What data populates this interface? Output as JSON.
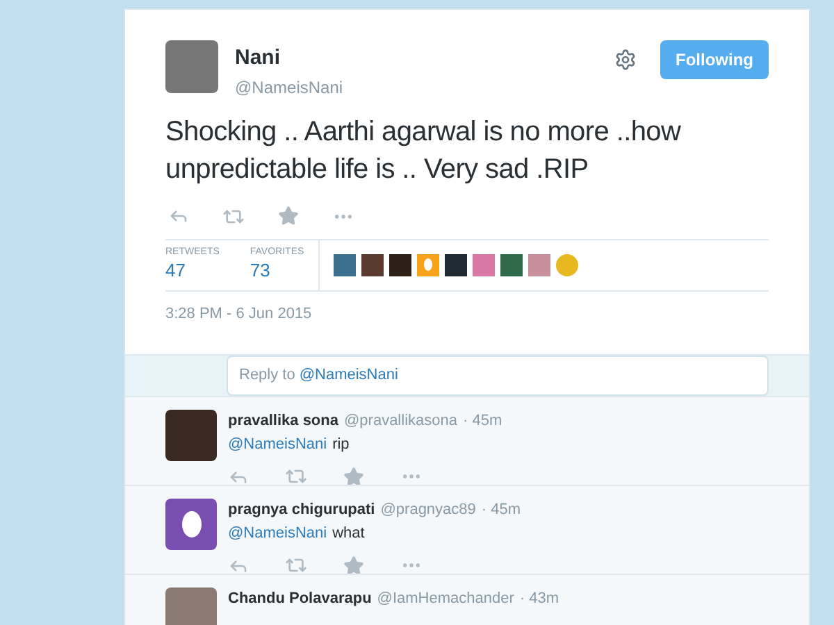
{
  "tweet": {
    "name": "Nani",
    "handle": "@NameisNani",
    "follow_button": "Following",
    "text": "Shocking .. Aarthi agarwal is no more ..how unpredictable life is .. Very sad .RIP",
    "stats": [
      {
        "label": "RETWEETS",
        "value": "47"
      },
      {
        "label": "FAVORITES",
        "value": "73"
      }
    ],
    "favoriters": [
      {
        "kind": "photo",
        "color": "#3d6f8f"
      },
      {
        "kind": "photo",
        "color": "#5a3a2e"
      },
      {
        "kind": "photo",
        "color": "#2e2118"
      },
      {
        "kind": "egg",
        "color": "#f7a21b"
      },
      {
        "kind": "photo",
        "color": "#1f2a33"
      },
      {
        "kind": "photo",
        "color": "#d97aa6"
      },
      {
        "kind": "photo",
        "color": "#2f6a4a"
      },
      {
        "kind": "photo",
        "color": "#c98f9c"
      },
      {
        "kind": "emoji",
        "color": "#e8b820"
      }
    ],
    "timestamp": "3:28 PM - 6 Jun 2015"
  },
  "reply_box": {
    "prefix": "Reply to",
    "mention": "@NameisNani"
  },
  "replies": [
    {
      "name": "pravallika sona",
      "handle": "@pravallikasona",
      "time": "· 45m",
      "mention": "@NameisNani",
      "text": "rip",
      "avatar": {
        "kind": "photo",
        "color": "#3a2a22"
      }
    },
    {
      "name": "pragnya chigurupati",
      "handle": "@pragnyac89",
      "time": "· 45m",
      "mention": "@NameisNani",
      "text": "what",
      "avatar": {
        "kind": "egg",
        "color": "#7a4db0"
      }
    },
    {
      "name": "Chandu Polavarapu",
      "handle": "@IamHemachander",
      "time": "· 43m",
      "avatar": {
        "kind": "photo",
        "color": "#8a7a70"
      }
    }
  ]
}
